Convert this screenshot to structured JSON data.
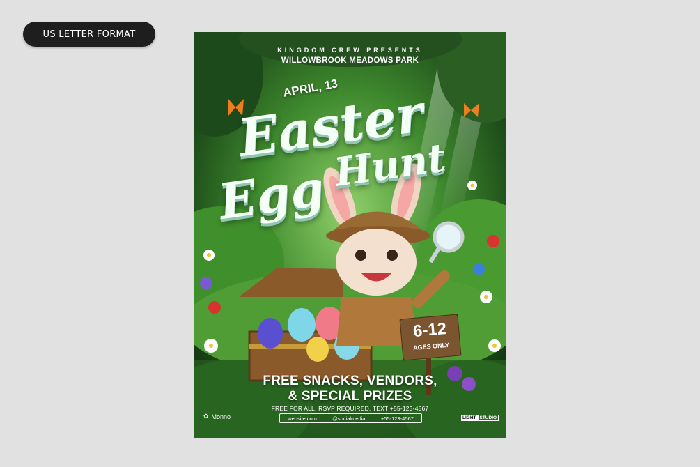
{
  "badge": {
    "label": "US LETTER FORMAT"
  },
  "poster": {
    "presenter": "KINGDOM CREW PRESENTS",
    "venue": "WILLOWBROOK MEADOWS PARK",
    "date": "APRIL, 13",
    "title_line1": "Easter",
    "title_line2a": "Egg",
    "title_line2b": "Hunt",
    "age_range": "6-12",
    "age_note": "AGES ONLY",
    "headline1": "FREE SNACKS, VENDORS,",
    "headline2": "& SPECIAL PRIZES",
    "details": "FREE FOR ALL, RSVP REQUIRED, TEXT +55-123-4567",
    "website": "website.com",
    "social": "@socialmedia",
    "phone": "+55-123-4567",
    "brand_left": "Monno",
    "brand_right_a": "LIGHT",
    "brand_right_b": "STUDIO"
  },
  "colors": {
    "page_bg": "#e1e1e1",
    "badge_bg": "#1e1e1e",
    "forest_dark": "#1f4d1c",
    "forest_light": "#6fbf4a",
    "title_fill": "#f4fff6",
    "wood": "#8a5a2b"
  }
}
